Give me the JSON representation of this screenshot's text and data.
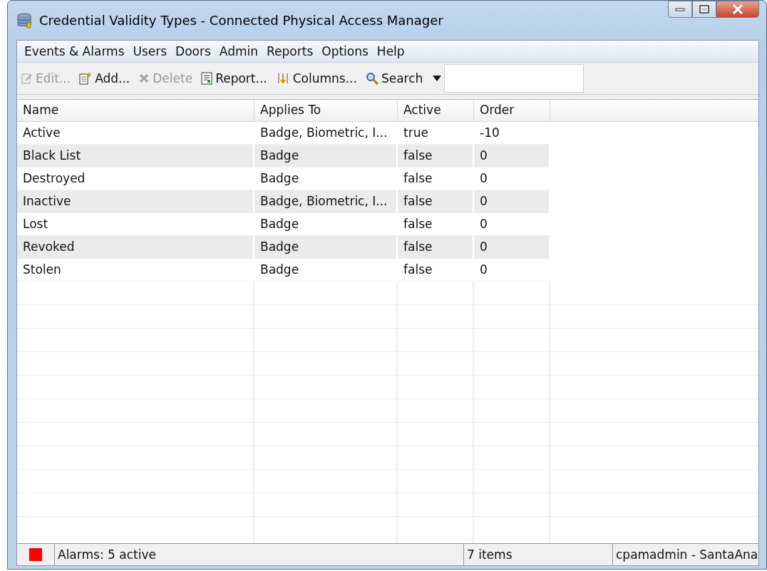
{
  "window": {
    "title": "Credential Validity Types - Connected Physical Access Manager"
  },
  "menu": [
    "Events & Alarms",
    "Users",
    "Doors",
    "Admin",
    "Reports",
    "Options",
    "Help"
  ],
  "toolbar": [
    {
      "label": "Edit...",
      "kind": "edit",
      "disabled": true
    },
    {
      "label": "Add...",
      "kind": "add",
      "disabled": false
    },
    {
      "label": "Delete",
      "kind": "delete",
      "disabled": true
    },
    {
      "label": "Report...",
      "kind": "report",
      "disabled": false
    },
    {
      "label": "Columns...",
      "kind": "columns",
      "disabled": false
    },
    {
      "label": "Search",
      "kind": "search",
      "disabled": false
    }
  ],
  "table": {
    "columns": [
      "Name",
      "Applies To",
      "Active",
      "Order"
    ],
    "rows": [
      [
        "Active",
        "Badge, Biometric, I...",
        "true",
        "-10"
      ],
      [
        "Black List",
        "Badge",
        "false",
        "0"
      ],
      [
        "Destroyed",
        "Badge",
        "false",
        "0"
      ],
      [
        "Inactive",
        "Badge, Biometric, I...",
        "false",
        "0"
      ],
      [
        "Lost",
        "Badge",
        "false",
        "0"
      ],
      [
        "Revoked",
        "Badge",
        "false",
        "0"
      ],
      [
        "Stolen",
        "Badge",
        "false",
        "0"
      ]
    ]
  },
  "status_bar": {
    "alarms": "Alarms: 5 active",
    "count": "7 items",
    "user": "cpamadmin - SantaAna"
  }
}
